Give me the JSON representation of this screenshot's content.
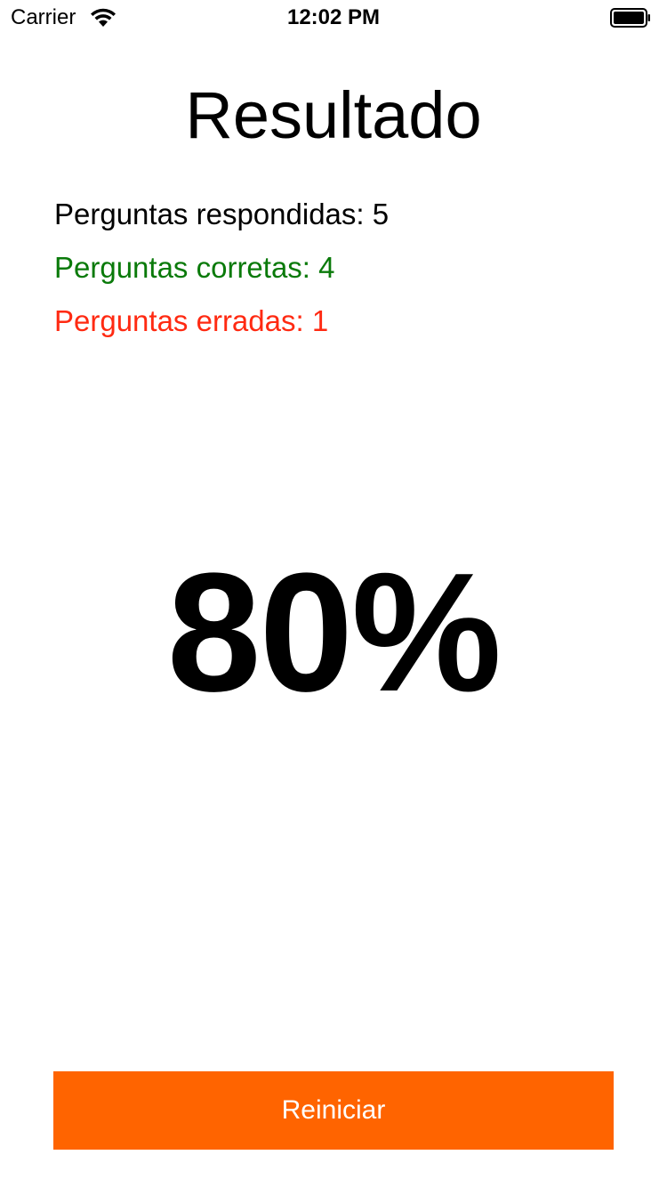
{
  "status_bar": {
    "carrier": "Carrier",
    "time": "12:02 PM",
    "icons": [
      "wifi-icon",
      "battery-icon"
    ]
  },
  "screen": {
    "title": "Resultado",
    "stats": {
      "answered": "Perguntas respondidas: 5",
      "correct": "Perguntas corretas: 4",
      "wrong": "Perguntas erradas: 1"
    },
    "percentage": "80%",
    "restart_label": "Reiniciar"
  },
  "colors": {
    "correct": "#0a7a0a",
    "wrong": "#ff2a12",
    "button_bg": "#ff6400",
    "button_text": "#ffffff"
  }
}
